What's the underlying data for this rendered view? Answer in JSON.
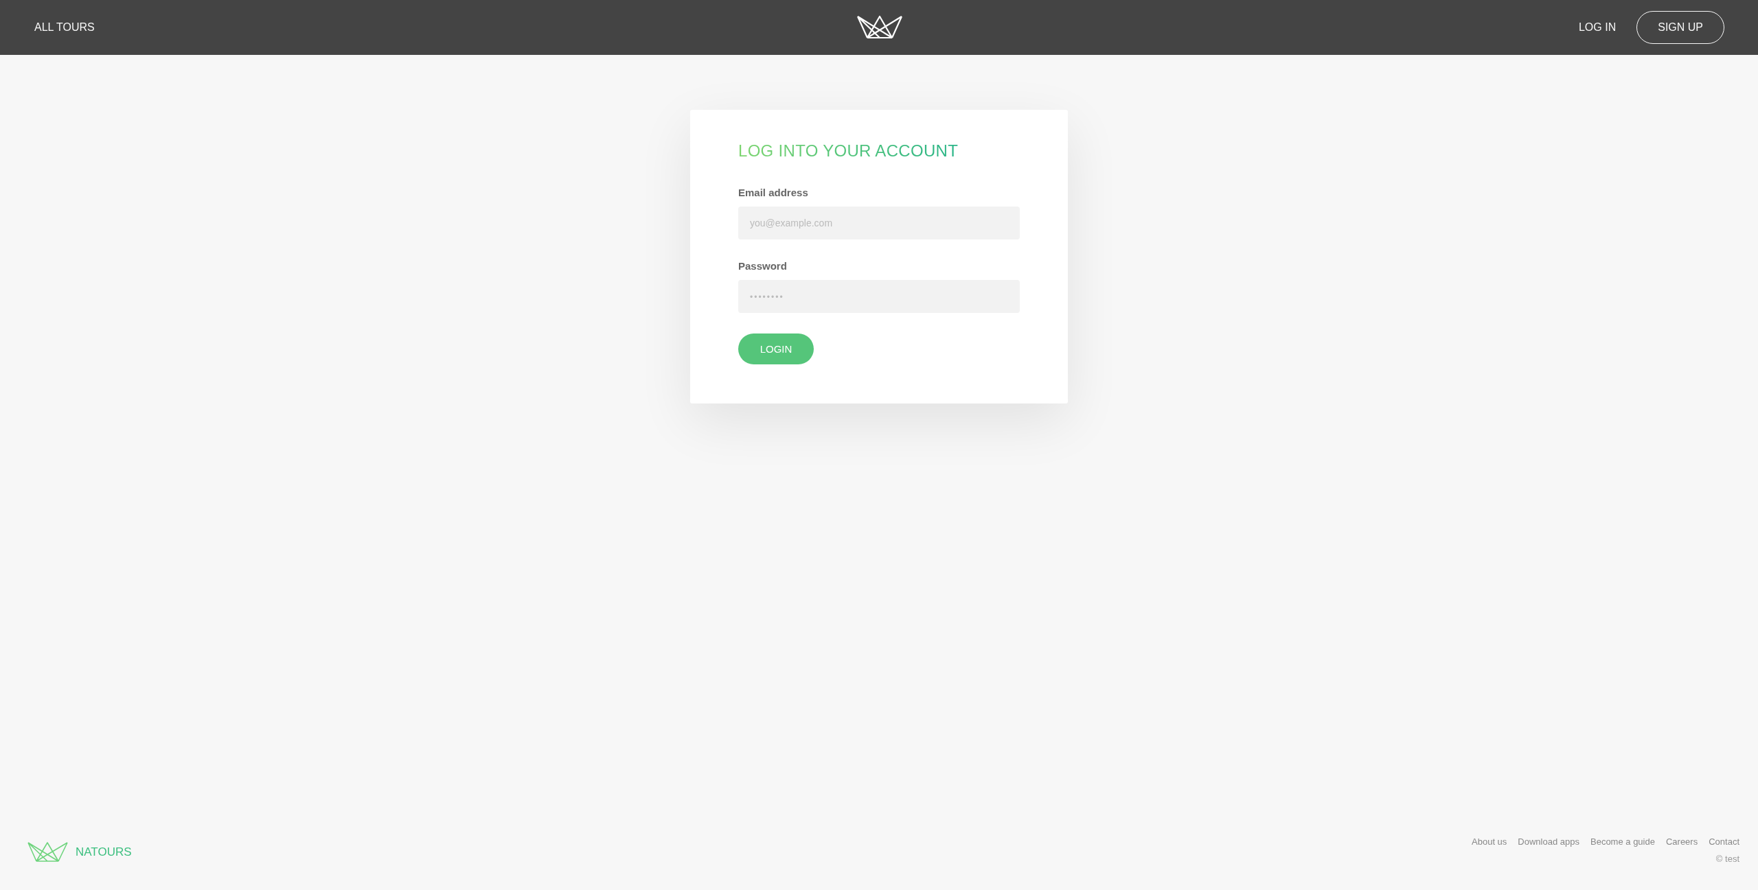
{
  "header": {
    "nav_left": {
      "label": "ALL TOURS"
    },
    "nav_right": [
      {
        "label": "LOG IN",
        "kind": "link"
      },
      {
        "label": "SIGN UP",
        "kind": "button"
      }
    ]
  },
  "login_form": {
    "title": "LOG INTO YOUR ACCOUNT",
    "fields": [
      {
        "label": "Email address",
        "placeholder": "you@example.com"
      },
      {
        "label": "Password",
        "placeholder": "••••••••"
      }
    ],
    "button": "LOGIN"
  },
  "footer": {
    "brand": "NATOURS",
    "links": [
      "About us",
      "Download apps",
      "Become a guide",
      "Careers",
      "Contact"
    ],
    "copyright": "© test"
  }
}
